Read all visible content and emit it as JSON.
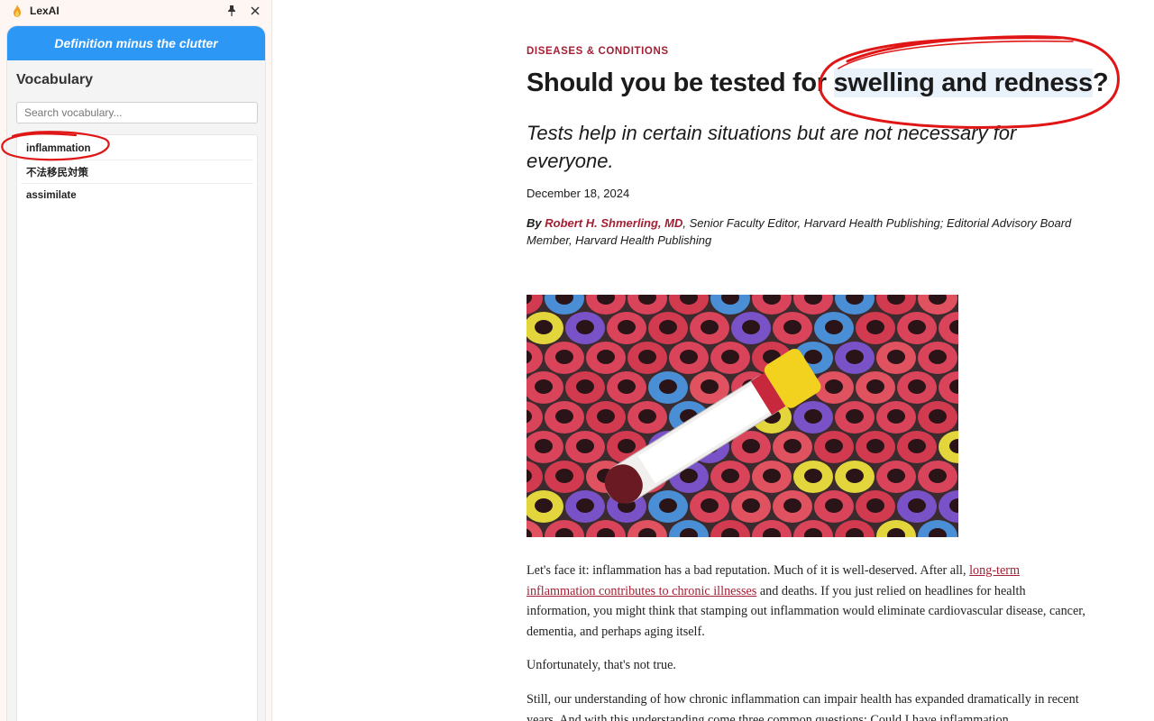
{
  "sidebar": {
    "app_title": "LexAI",
    "banner_text": "Definition minus the clutter",
    "heading": "Vocabulary",
    "search_placeholder": "Search vocabulary...",
    "items": [
      {
        "label": "inflammation"
      },
      {
        "label": "不法移民対策"
      },
      {
        "label": "assimilate"
      }
    ],
    "banner_color": "#2d97f5"
  },
  "article": {
    "category": "DISEASES & CONDITIONS",
    "headline_lead": "Should you be tested for ",
    "headline_highlight": "swelling and redness",
    "headline_end": "?",
    "subtitle": "Tests help in certain situations but are not necessary for everyone.",
    "date": "December 18, 2024",
    "byline_by": "By",
    "author": "Robert H. Shmerling, MD",
    "author_role": ", Senior Faculty Editor, Harvard Health Publishing; Editorial Advisory Board Member, Harvard Health Publishing",
    "para1_a": "Let's face it: inflammation has a bad reputation. Much of it is well-deserved. After all, ",
    "para1_link": "long-term inflammation contributes to chronic illnesses",
    "para1_b": " and deaths. If you just relied on headlines for health information, you might think that stamping out inflammation would eliminate cardiovascular disease, cancer, dementia, and perhaps aging itself.",
    "para2": "Unfortunately, that's not true.",
    "para3": "Still, our understanding of how chronic inflammation can impair health has expanded dramatically in recent years. And with this understanding come three common questions: Could I have inflammation",
    "accent_color": "#a31f34"
  }
}
